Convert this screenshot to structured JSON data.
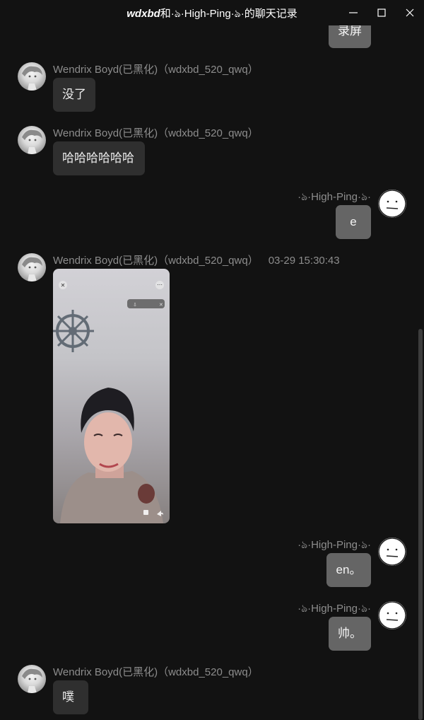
{
  "window": {
    "title_part1": "wdxbd",
    "title_part2": "和",
    "title_part3": "·ঌ·High-Ping·ঌ·",
    "title_part4": "的聊天记录"
  },
  "contacts": {
    "other": "Wendrix Boyd(已黑化)（wdxbd_520_qwq）",
    "self": "·ঌ·High-Ping·ঌ·"
  },
  "messages": [
    {
      "id": "m0",
      "side": "right",
      "text": "录屏"
    },
    {
      "id": "m1",
      "side": "left",
      "text": "没了"
    },
    {
      "id": "m2",
      "side": "left",
      "text": "哈哈哈哈哈哈"
    },
    {
      "id": "m3",
      "side": "right",
      "text": "e"
    },
    {
      "id": "m4",
      "side": "left",
      "type": "image",
      "timestamp": "03-29 15:30:43"
    },
    {
      "id": "m5",
      "side": "right",
      "text": "en。"
    },
    {
      "id": "m6",
      "side": "right",
      "text": "帅。"
    },
    {
      "id": "m7",
      "side": "left",
      "text": "噗"
    }
  ]
}
